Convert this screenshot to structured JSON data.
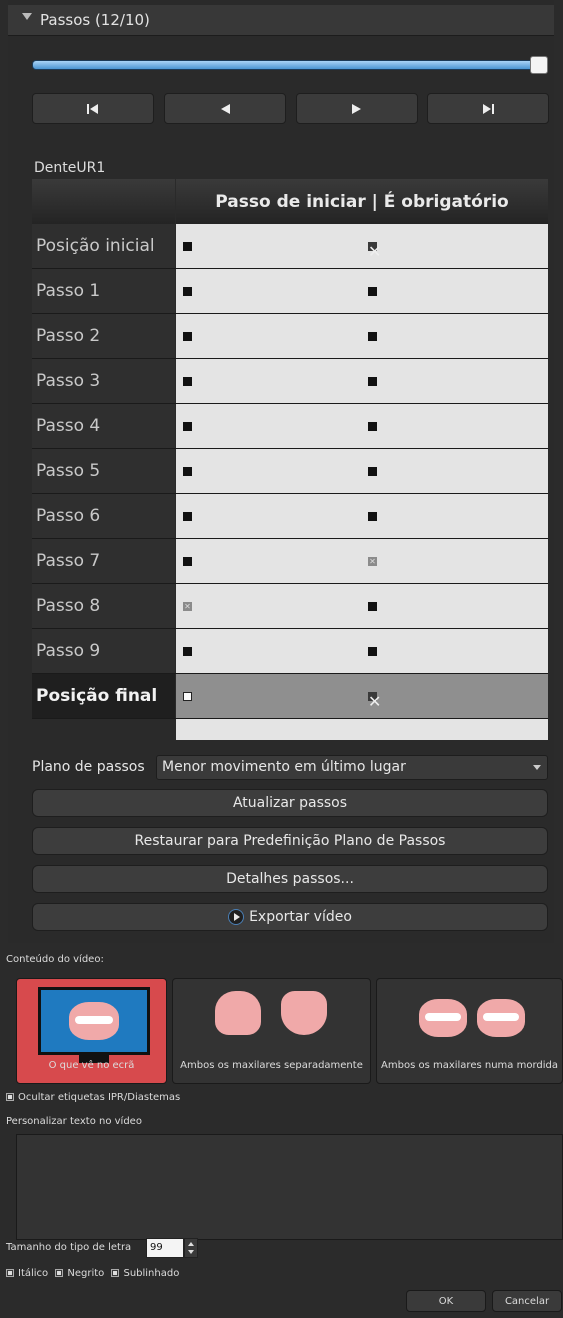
{
  "passos_panel": {
    "title": "Passos (12/10)"
  },
  "slider": {
    "value": 1.0
  },
  "nav": {
    "first": "⏮",
    "prev": "◀",
    "next": "▶",
    "last": "⏭"
  },
  "dente": {
    "label": "DenteUR1"
  },
  "table": {
    "column_header": "Passo de iniciar | É obrigatório",
    "rows": [
      {
        "label": "Posição inicial"
      },
      {
        "label": "Passo 1"
      },
      {
        "label": "Passo 2"
      },
      {
        "label": "Passo 3"
      },
      {
        "label": "Passo 4"
      },
      {
        "label": "Passo 5"
      },
      {
        "label": "Passo 6"
      },
      {
        "label": "Passo 7"
      },
      {
        "label": "Passo 8"
      },
      {
        "label": "Passo 9"
      },
      {
        "label": "Posição final"
      }
    ]
  },
  "plano": {
    "label": "Plano de passos",
    "selected": "Menor movimento em último lugar"
  },
  "buttons": {
    "atualizar": "Atualizar passos",
    "restaurar": "Restaurar para Predefinição Plano de Passos",
    "detalhes": "Detalhes passos...",
    "exportar": "Exportar vídeo"
  },
  "video": {
    "title": "Conteúdo do vídeo:",
    "options": [
      {
        "label": "O que vê no ecrã"
      },
      {
        "label": "Ambos os maxilares separadamente"
      },
      {
        "label": "Ambos os maxilares numa mordida"
      }
    ],
    "hide_labels": "Ocultar etiquetas IPR/Diastemas",
    "custom_text_label": "Personalizar texto no vídeo",
    "font_size_label": "Tamanho do tipo de letra",
    "font_size_value": "99",
    "italic": "Itálico",
    "bold": "Negrito",
    "underline": "Sublinhado",
    "ok": "OK",
    "cancel": "Cancelar"
  }
}
